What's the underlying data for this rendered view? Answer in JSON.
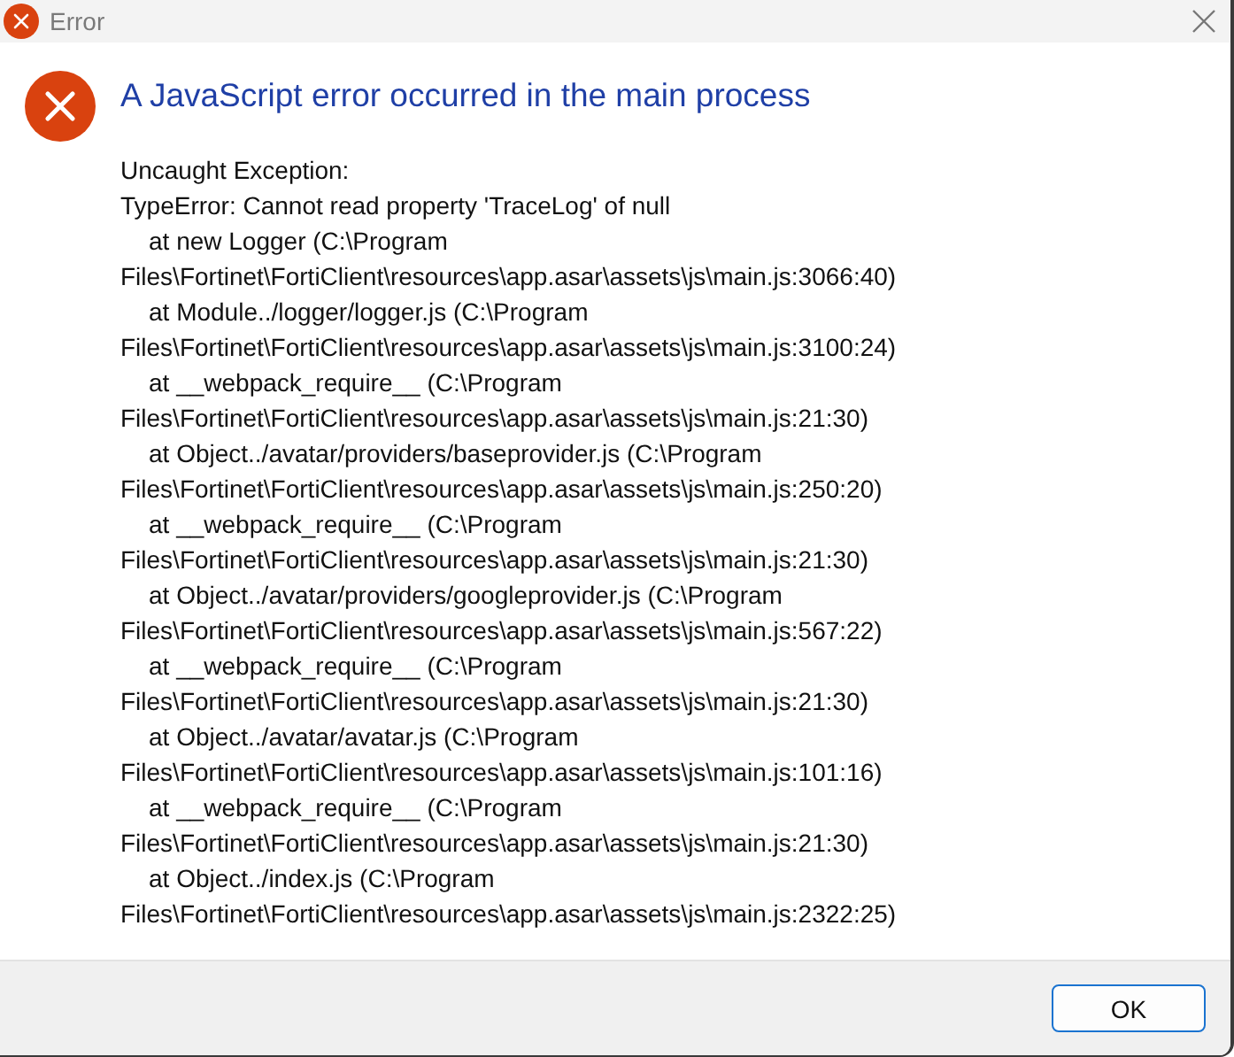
{
  "window": {
    "title": "Error"
  },
  "heading": "A JavaScript error occurred in the main process",
  "lines": [
    {
      "kind": "plain",
      "text": "Uncaught Exception:"
    },
    {
      "kind": "plain",
      "text": "TypeError: Cannot read property 'TraceLog' of null"
    },
    {
      "kind": "frame",
      "text": "at new Logger (C:\\Program"
    },
    {
      "kind": "plain",
      "text": "Files\\Fortinet\\FortiClient\\resources\\app.asar\\assets\\js\\main.js:3066:40)"
    },
    {
      "kind": "frame",
      "text": "at Module../logger/logger.js (C:\\Program"
    },
    {
      "kind": "plain",
      "text": "Files\\Fortinet\\FortiClient\\resources\\app.asar\\assets\\js\\main.js:3100:24)"
    },
    {
      "kind": "frame",
      "text": "at __webpack_require__ (C:\\Program"
    },
    {
      "kind": "plain",
      "text": "Files\\Fortinet\\FortiClient\\resources\\app.asar\\assets\\js\\main.js:21:30)"
    },
    {
      "kind": "frame",
      "text": "at Object../avatar/providers/baseprovider.js (C:\\Program"
    },
    {
      "kind": "plain",
      "text": "Files\\Fortinet\\FortiClient\\resources\\app.asar\\assets\\js\\main.js:250:20)"
    },
    {
      "kind": "frame",
      "text": "at __webpack_require__ (C:\\Program"
    },
    {
      "kind": "plain",
      "text": "Files\\Fortinet\\FortiClient\\resources\\app.asar\\assets\\js\\main.js:21:30)"
    },
    {
      "kind": "frame",
      "text": "at Object../avatar/providers/googleprovider.js (C:\\Program"
    },
    {
      "kind": "plain",
      "text": "Files\\Fortinet\\FortiClient\\resources\\app.asar\\assets\\js\\main.js:567:22)"
    },
    {
      "kind": "frame",
      "text": "at __webpack_require__ (C:\\Program"
    },
    {
      "kind": "plain",
      "text": "Files\\Fortinet\\FortiClient\\resources\\app.asar\\assets\\js\\main.js:21:30)"
    },
    {
      "kind": "frame",
      "text": "at Object../avatar/avatar.js (C:\\Program"
    },
    {
      "kind": "plain",
      "text": "Files\\Fortinet\\FortiClient\\resources\\app.asar\\assets\\js\\main.js:101:16)"
    },
    {
      "kind": "frame",
      "text": "at __webpack_require__ (C:\\Program"
    },
    {
      "kind": "plain",
      "text": "Files\\Fortinet\\FortiClient\\resources\\app.asar\\assets\\js\\main.js:21:30)"
    },
    {
      "kind": "frame",
      "text": "at Object../index.js (C:\\Program"
    },
    {
      "kind": "plain",
      "text": "Files\\Fortinet\\FortiClient\\resources\\app.asar\\assets\\js\\main.js:2322:25)"
    }
  ],
  "buttons": [
    "OK"
  ]
}
